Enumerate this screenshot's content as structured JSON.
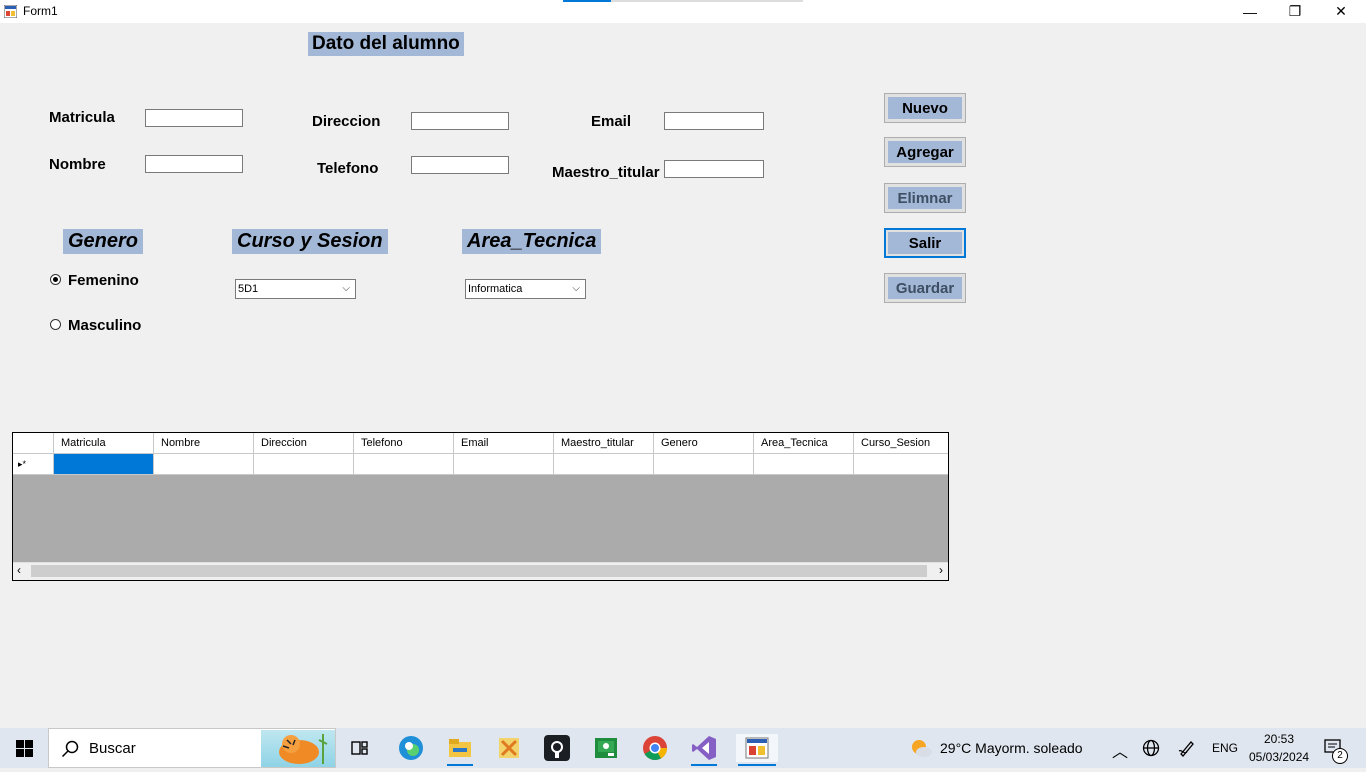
{
  "window": {
    "title": "Form1",
    "minimize": "—",
    "restore": "❐",
    "close": "✕"
  },
  "form": {
    "header": "Dato del alumno",
    "fields": {
      "matricula": {
        "label": "Matricula",
        "value": ""
      },
      "nombre": {
        "label": "Nombre",
        "value": ""
      },
      "direccion": {
        "label": "Direccion",
        "value": ""
      },
      "telefono": {
        "label": "Telefono",
        "value": ""
      },
      "email": {
        "label": "Email",
        "value": ""
      },
      "maestro": {
        "label": "Maestro_titular",
        "value": ""
      }
    },
    "genero": {
      "header": "Genero",
      "options": [
        {
          "label": "Femenino",
          "checked": true
        },
        {
          "label": "Masculino",
          "checked": false
        }
      ]
    },
    "curso": {
      "header": "Curso y Sesion",
      "selected": "5D1"
    },
    "area": {
      "header": "Area_Tecnica",
      "selected": "Informatica"
    },
    "buttons": {
      "nuevo": "Nuevo",
      "agregar": "Agregar",
      "eliminar": "Elimnar",
      "salir": "Salir",
      "guardar": "Guardar"
    }
  },
  "grid": {
    "columns": [
      "Matricula",
      "Nombre",
      "Direccion",
      "Telefono",
      "Email",
      "Maestro_titular",
      "Genero",
      "Area_Tecnica",
      "Curso_Sesion"
    ],
    "new_row_marker": "▸*"
  },
  "taskbar": {
    "search_placeholder": "Buscar",
    "weather": "29°C  Mayorm. soleado",
    "lang": "ENG",
    "time": "20:53",
    "date": "05/03/2024",
    "notifications": "2",
    "colors": {
      "accent": "#0078d7",
      "label_bg": "#a3b8d6"
    }
  }
}
